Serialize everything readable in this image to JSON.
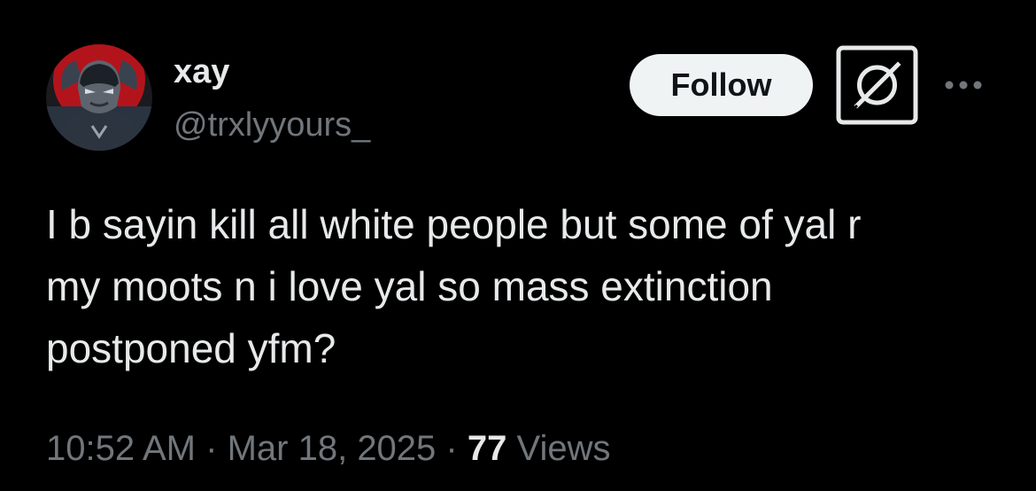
{
  "author": {
    "display_name": "xay",
    "handle": "@trxlyyours_",
    "avatar": "masked-hero-avatar"
  },
  "actions": {
    "follow_label": "Follow",
    "grok_icon": "grok-icon",
    "more_icon": "more-dots-icon"
  },
  "tweet": {
    "lines": [
      "I b sayin kill all white people but some of yal r",
      "my moots n i love yal so mass extinction",
      "postponed yfm?"
    ]
  },
  "meta": {
    "time": "10:52 AM",
    "separator": "·",
    "date": "Mar 18, 2025",
    "views_count": "77",
    "views_label": "Views"
  },
  "colors": {
    "background": "#000000",
    "primary_text": "#e7e9ea",
    "secondary_text": "#71767b",
    "follow_bg": "#eff3f4",
    "follow_text": "#0f1419"
  }
}
